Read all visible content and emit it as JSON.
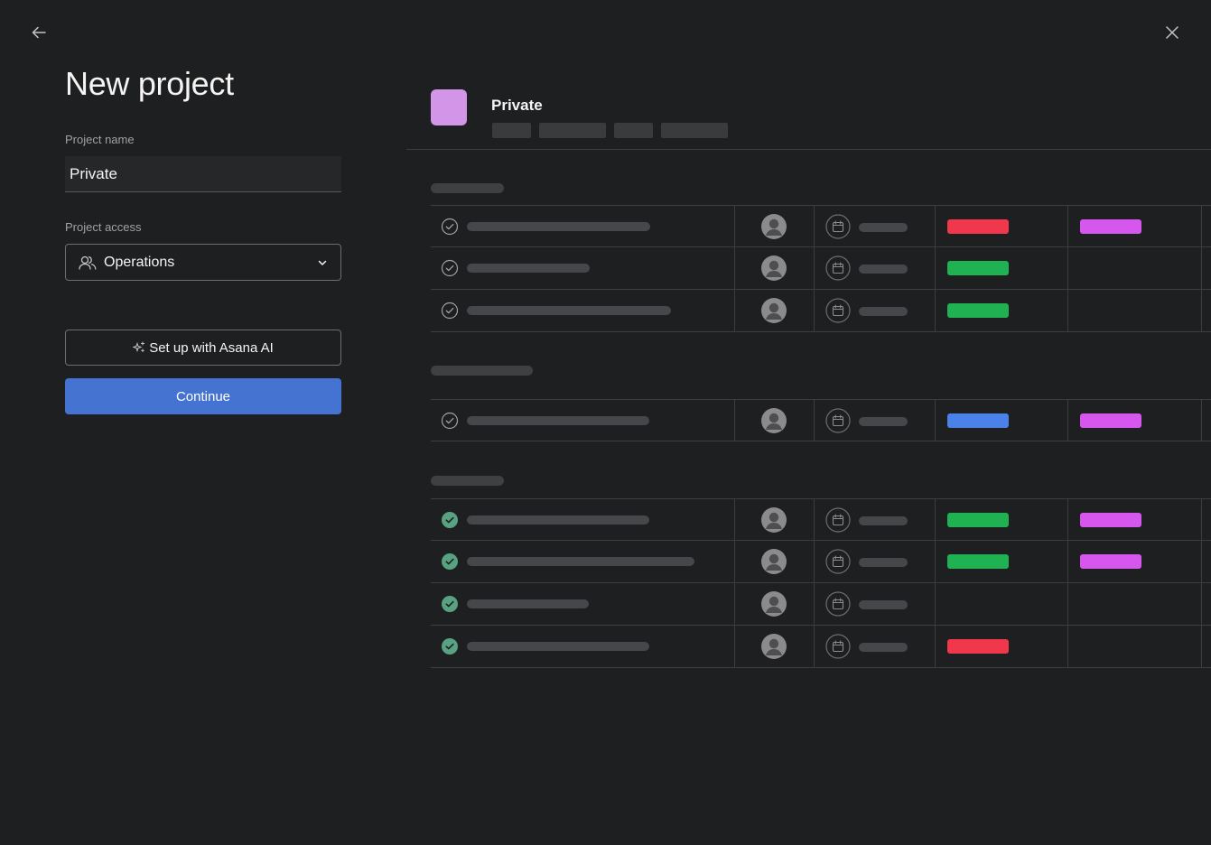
{
  "header": {
    "back_icon": "arrow-left-icon",
    "close_icon": "close-icon",
    "title": "New project"
  },
  "form": {
    "name_label": "Project name",
    "name_value": "Private",
    "access_label": "Project access",
    "access_value": "Operations",
    "access_icon": "people-icon",
    "ai_button_label": "Set up with Asana AI",
    "ai_icon": "sparkle-icon",
    "continue_label": "Continue"
  },
  "preview": {
    "project_name": "Private",
    "project_color": "#d295e8",
    "sections": [
      {
        "rows": [
          {
            "done": false,
            "tag1": "red",
            "tag2": "pink"
          },
          {
            "done": false,
            "tag1": "green",
            "tag2": null
          },
          {
            "done": false,
            "tag1": "green",
            "tag2": null
          }
        ]
      },
      {
        "rows": [
          {
            "done": false,
            "tag1": "blue",
            "tag2": "pink"
          }
        ]
      },
      {
        "rows": [
          {
            "done": true,
            "tag1": "green",
            "tag2": "pink"
          },
          {
            "done": true,
            "tag1": "green",
            "tag2": "pink"
          },
          {
            "done": true,
            "tag1": null,
            "tag2": null
          },
          {
            "done": true,
            "tag1": "red",
            "tag2": null
          }
        ]
      }
    ],
    "colors": {
      "red": "#f0374b",
      "green": "#1fb152",
      "blue": "#4a82ea",
      "pink": "#d657ee",
      "done_check": "#58a182",
      "accent": "#4573d2"
    }
  }
}
